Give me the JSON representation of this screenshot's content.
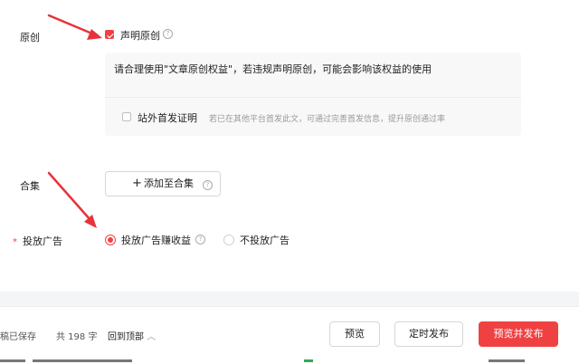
{
  "original": {
    "label": "原创",
    "checkbox_label": "声明原创",
    "checked": true,
    "notice": "请合理使用\"文章原创权益\"，若违规声明原创，可能会影响该权益的使用",
    "offsite": {
      "label": "站外首发证明",
      "checked": false,
      "hint": "若已在其他平台首发此文，可通过完善首发信息，提升原创通过率"
    }
  },
  "collection": {
    "label": "合集",
    "add_button": "添加至合集",
    "add_icon": "plus-icon"
  },
  "ads": {
    "required_mark": "*",
    "label": "投放广告",
    "options": [
      {
        "label": "投放广告赚收益",
        "selected": true
      },
      {
        "label": "不投放广告",
        "selected": false
      }
    ]
  },
  "footer": {
    "save_status": "稿已保存",
    "word_count": "共 198 字",
    "back_to_top": "回到顶部",
    "back_to_top_icon": "chevron-up-icon",
    "preview": "预览",
    "schedule": "定时发布",
    "publish": "预览并发布"
  },
  "colors": {
    "accent": "#f04142",
    "annotation_arrow": "#e8333a"
  }
}
